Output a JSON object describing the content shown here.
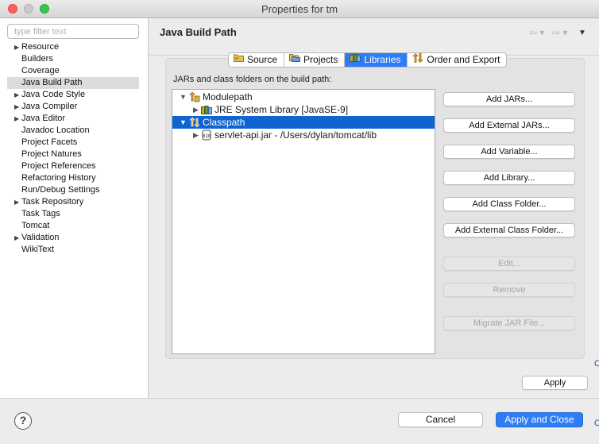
{
  "window": {
    "title": "Properties for tm"
  },
  "filter": {
    "placeholder": "type filter text",
    "value": ""
  },
  "nav": {
    "items": [
      {
        "label": "Resource",
        "expandable": true,
        "selected": false
      },
      {
        "label": "Builders",
        "expandable": false,
        "selected": false
      },
      {
        "label": "Coverage",
        "expandable": false,
        "selected": false
      },
      {
        "label": "Java Build Path",
        "expandable": false,
        "selected": true
      },
      {
        "label": "Java Code Style",
        "expandable": true,
        "selected": false
      },
      {
        "label": "Java Compiler",
        "expandable": true,
        "selected": false
      },
      {
        "label": "Java Editor",
        "expandable": true,
        "selected": false
      },
      {
        "label": "Javadoc Location",
        "expandable": false,
        "selected": false
      },
      {
        "label": "Project Facets",
        "expandable": false,
        "selected": false
      },
      {
        "label": "Project Natures",
        "expandable": false,
        "selected": false
      },
      {
        "label": "Project References",
        "expandable": false,
        "selected": false
      },
      {
        "label": "Refactoring History",
        "expandable": false,
        "selected": false
      },
      {
        "label": "Run/Debug Settings",
        "expandable": false,
        "selected": false
      },
      {
        "label": "Task Repository",
        "expandable": true,
        "selected": false
      },
      {
        "label": "Task Tags",
        "expandable": false,
        "selected": false
      },
      {
        "label": "Tomcat",
        "expandable": false,
        "selected": false
      },
      {
        "label": "Validation",
        "expandable": true,
        "selected": false
      },
      {
        "label": "WikiText",
        "expandable": false,
        "selected": false
      }
    ]
  },
  "page": {
    "title": "Java Build Path",
    "nav_back_icon": "⇦ ▾",
    "nav_forward_icon": "⇨ ▾",
    "menu_icon": "▼"
  },
  "tabs": [
    {
      "label": "Source",
      "icon": "source-folder-icon",
      "active": false
    },
    {
      "label": "Projects",
      "icon": "projects-icon",
      "active": false
    },
    {
      "label": "Libraries",
      "icon": "libraries-icon",
      "active": true
    },
    {
      "label": "Order and Export",
      "icon": "order-export-icon",
      "active": false
    }
  ],
  "libraries": {
    "section_label": "JARs and class folders on the build path:",
    "tree": [
      {
        "label": "Modulepath",
        "level": 0,
        "expanded": true,
        "selected": false,
        "icon": "modulepath-icon"
      },
      {
        "label": "JRE System Library [JavaSE-9]",
        "level": 1,
        "expanded": false,
        "selected": false,
        "icon": "jre-library-icon"
      },
      {
        "label": "Classpath",
        "level": 0,
        "expanded": true,
        "selected": true,
        "icon": "classpath-icon"
      },
      {
        "label": "servlet-api.jar - /Users/dylan/tomcat/lib",
        "level": 1,
        "expanded": false,
        "selected": false,
        "icon": "jar-icon"
      }
    ],
    "buttons": [
      {
        "label": "Add JARs...",
        "enabled": true
      },
      {
        "label": "Add External JARs...",
        "enabled": true
      },
      {
        "label": "Add Variable...",
        "enabled": true
      },
      {
        "label": "Add Library...",
        "enabled": true
      },
      {
        "label": "Add Class Folder...",
        "enabled": true
      },
      {
        "label": "Add External Class Folder...",
        "enabled": true
      },
      {
        "label": "Edit...",
        "enabled": false
      },
      {
        "label": "Remove",
        "enabled": false
      },
      {
        "label": "Migrate JAR File...",
        "enabled": false
      }
    ]
  },
  "actions": {
    "apply": "Apply",
    "cancel": "Cancel",
    "apply_close": "Apply and Close",
    "help": "?"
  },
  "edge_text": {
    "top": "C",
    "bottom": "C"
  },
  "colors": {
    "selection": "#0f64d2",
    "accent": "#2e7cf6"
  }
}
